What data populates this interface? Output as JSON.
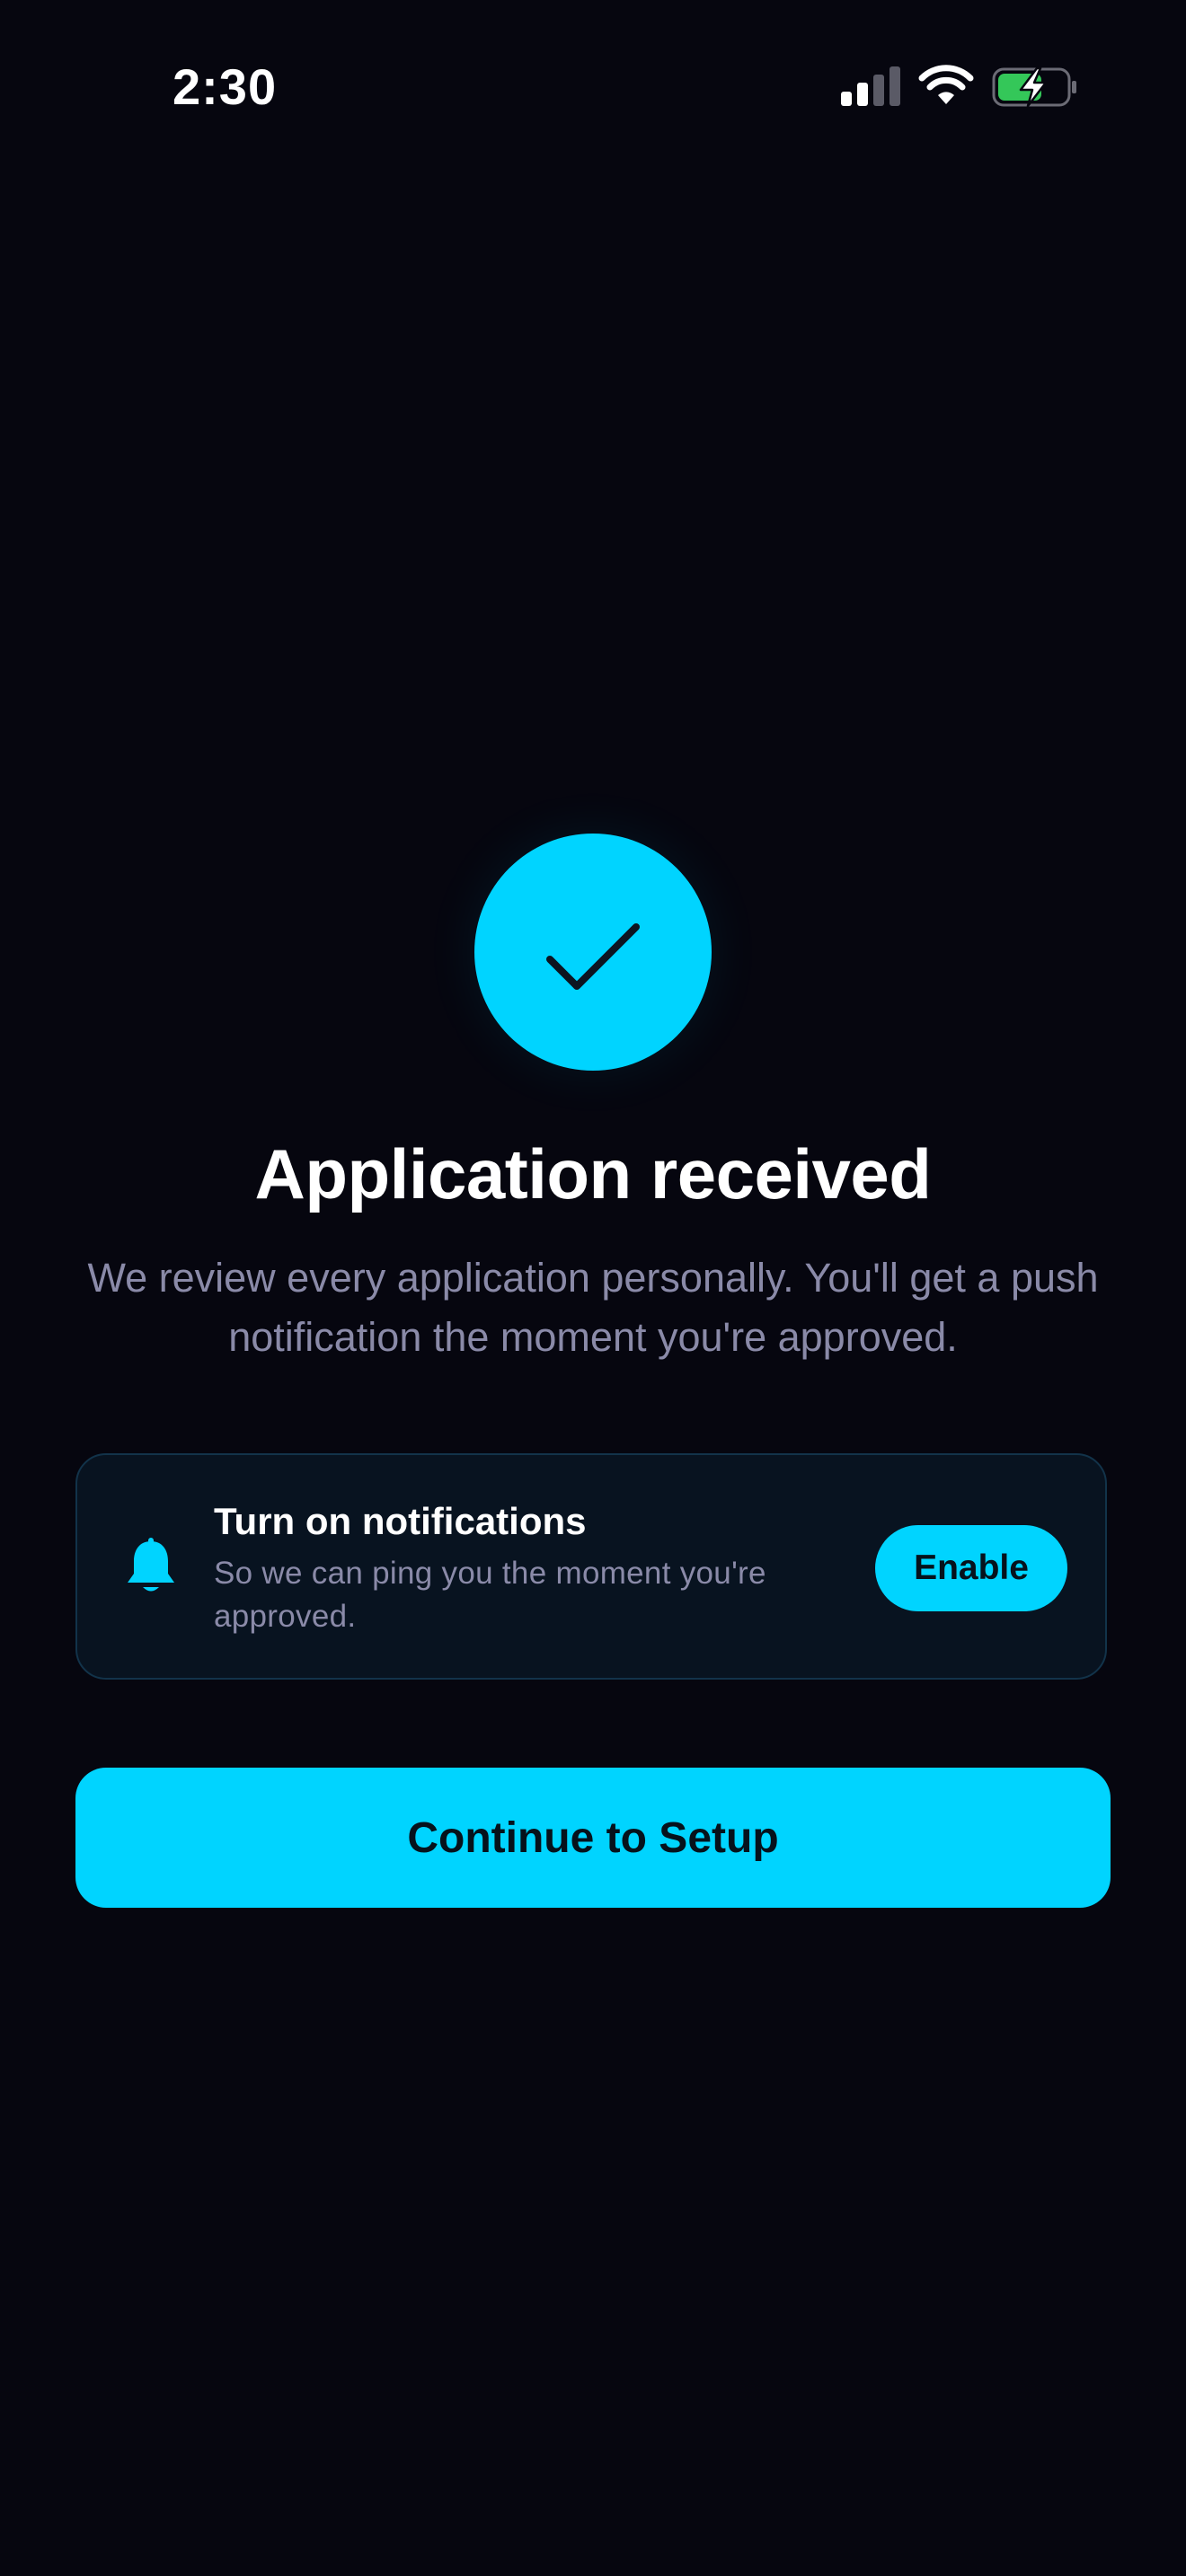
{
  "status_bar": {
    "time": "2:30",
    "icons": [
      "signal-icon",
      "wifi-icon",
      "battery-charging-icon"
    ]
  },
  "main": {
    "success_icon": "checkmark-icon",
    "title": "Application received",
    "subtitle": "We review every application personally. You'll get a push notification the moment you're approved."
  },
  "notification_card": {
    "icon": "bell-icon",
    "title": "Turn on notifications",
    "body": "So we can ping you the moment you're approved.",
    "enable_label": "Enable"
  },
  "continue_label": "Continue to Setup",
  "colors": {
    "background": "#06060f",
    "accent": "#00d4ff",
    "muted_text": "#8a8aa8",
    "card_background": "#081320",
    "card_border": "#12334a",
    "battery_green": "#34c759"
  }
}
